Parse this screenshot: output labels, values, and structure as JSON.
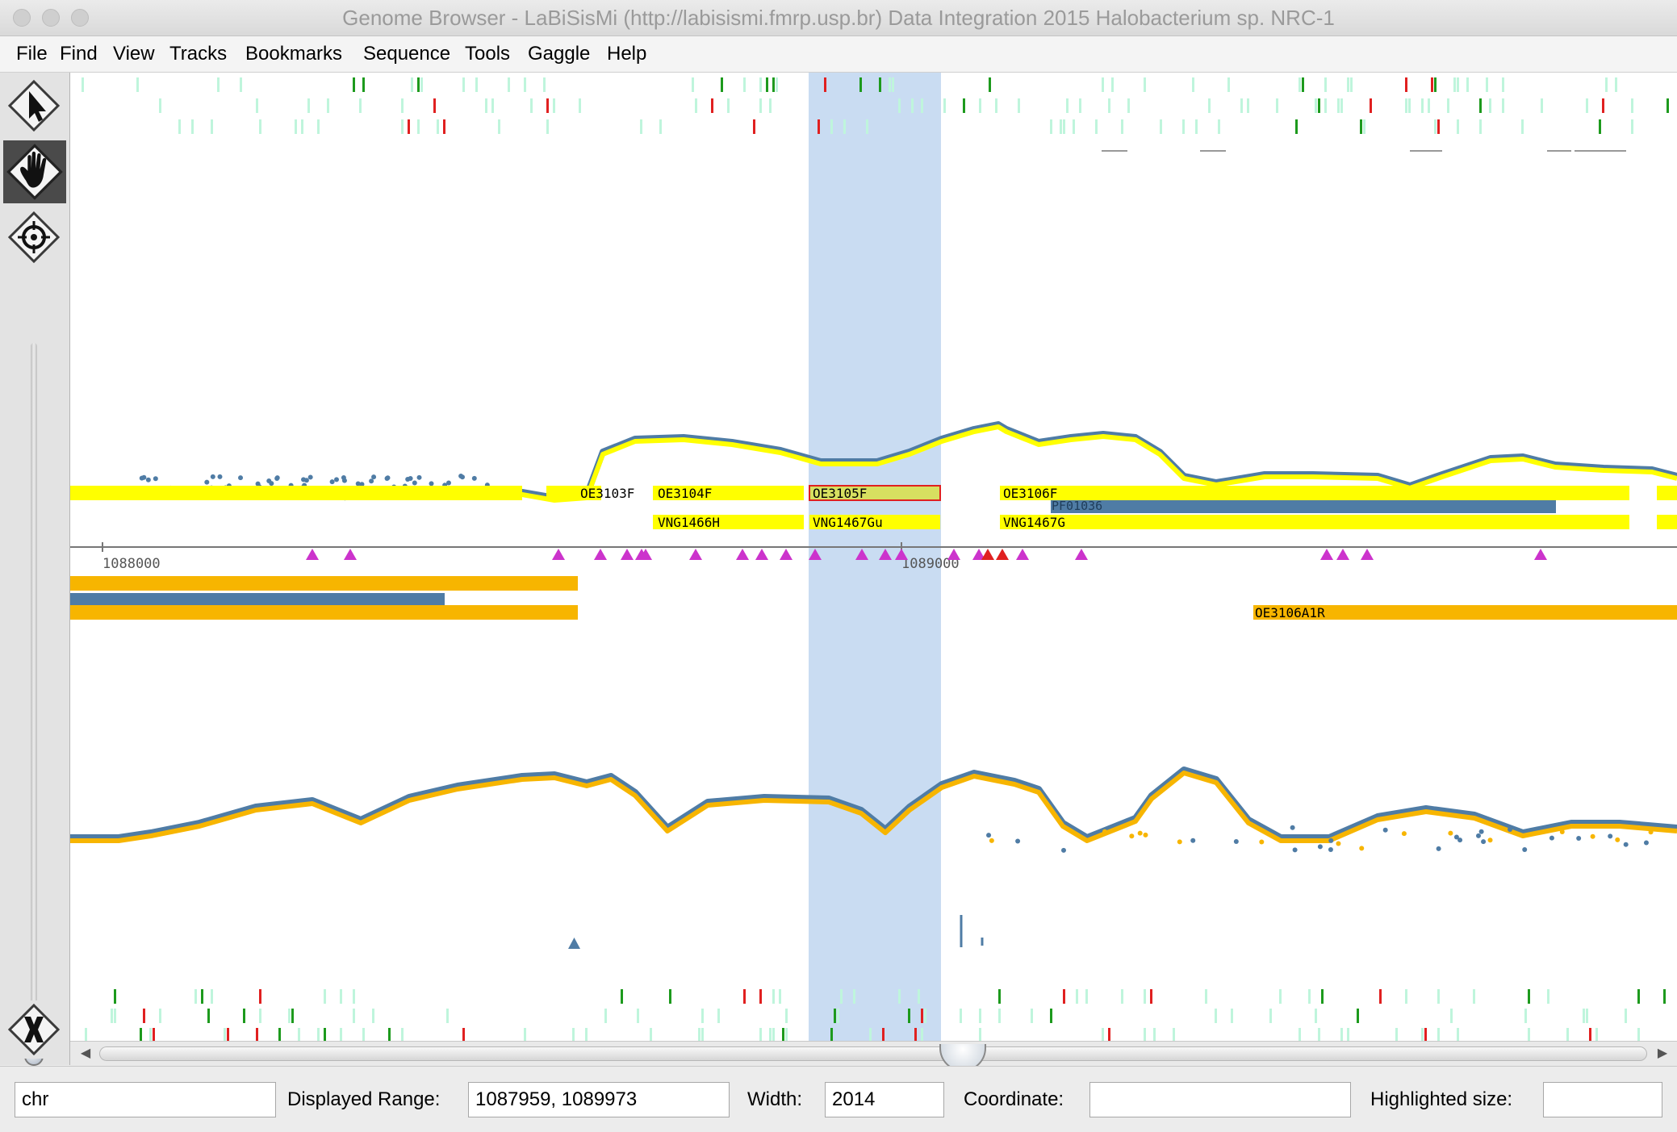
{
  "window": {
    "title": "Genome Browser - LaBiSisMi (http://labisismi.fmrp.usp.br) Data Integration 2015 Halobacterium sp. NRC-1"
  },
  "menu": [
    "File",
    "Find",
    "View",
    "Tracks",
    "Bookmarks",
    "Sequence",
    "Tools",
    "Gaggle",
    "Help"
  ],
  "tools": {
    "icons": [
      "arrow-pointer-icon",
      "hand-icon",
      "crosshair-icon",
      "close-x-icon"
    ],
    "active": "hand-icon"
  },
  "ruler": {
    "ticks": [
      "1088000",
      "1089000"
    ]
  },
  "genes": {
    "forward_upper": [
      "OE3103F",
      "OE3104F",
      "OE3105F",
      "OE3106F"
    ],
    "forward_lower": [
      "VNG1466H",
      "VNG1467Gu",
      "VNG1467G"
    ],
    "protein": [
      "PF01036"
    ],
    "reverse": [
      "OE3106A1R"
    ],
    "selected": "OE3105F"
  },
  "colors": {
    "forward_gene": "#ffff00",
    "reverse_gene": "#f7b500",
    "signal_blue": "#4f7ca5",
    "highlight": "#c9dcf2",
    "motif": "#cc33cc",
    "peak_red": "#e02020",
    "peak_green": "#1d9a1d",
    "peak_light": "#bff5dc"
  },
  "status": {
    "chr_value": "chr",
    "range_label": "Displayed Range:",
    "range_value": "1087959, 1089973",
    "width_label": "Width:",
    "width_value": "2014",
    "coordinate_label": "Coordinate:",
    "coordinate_value": "",
    "highlighted_label": "Highlighted size:",
    "highlighted_value": ""
  }
}
